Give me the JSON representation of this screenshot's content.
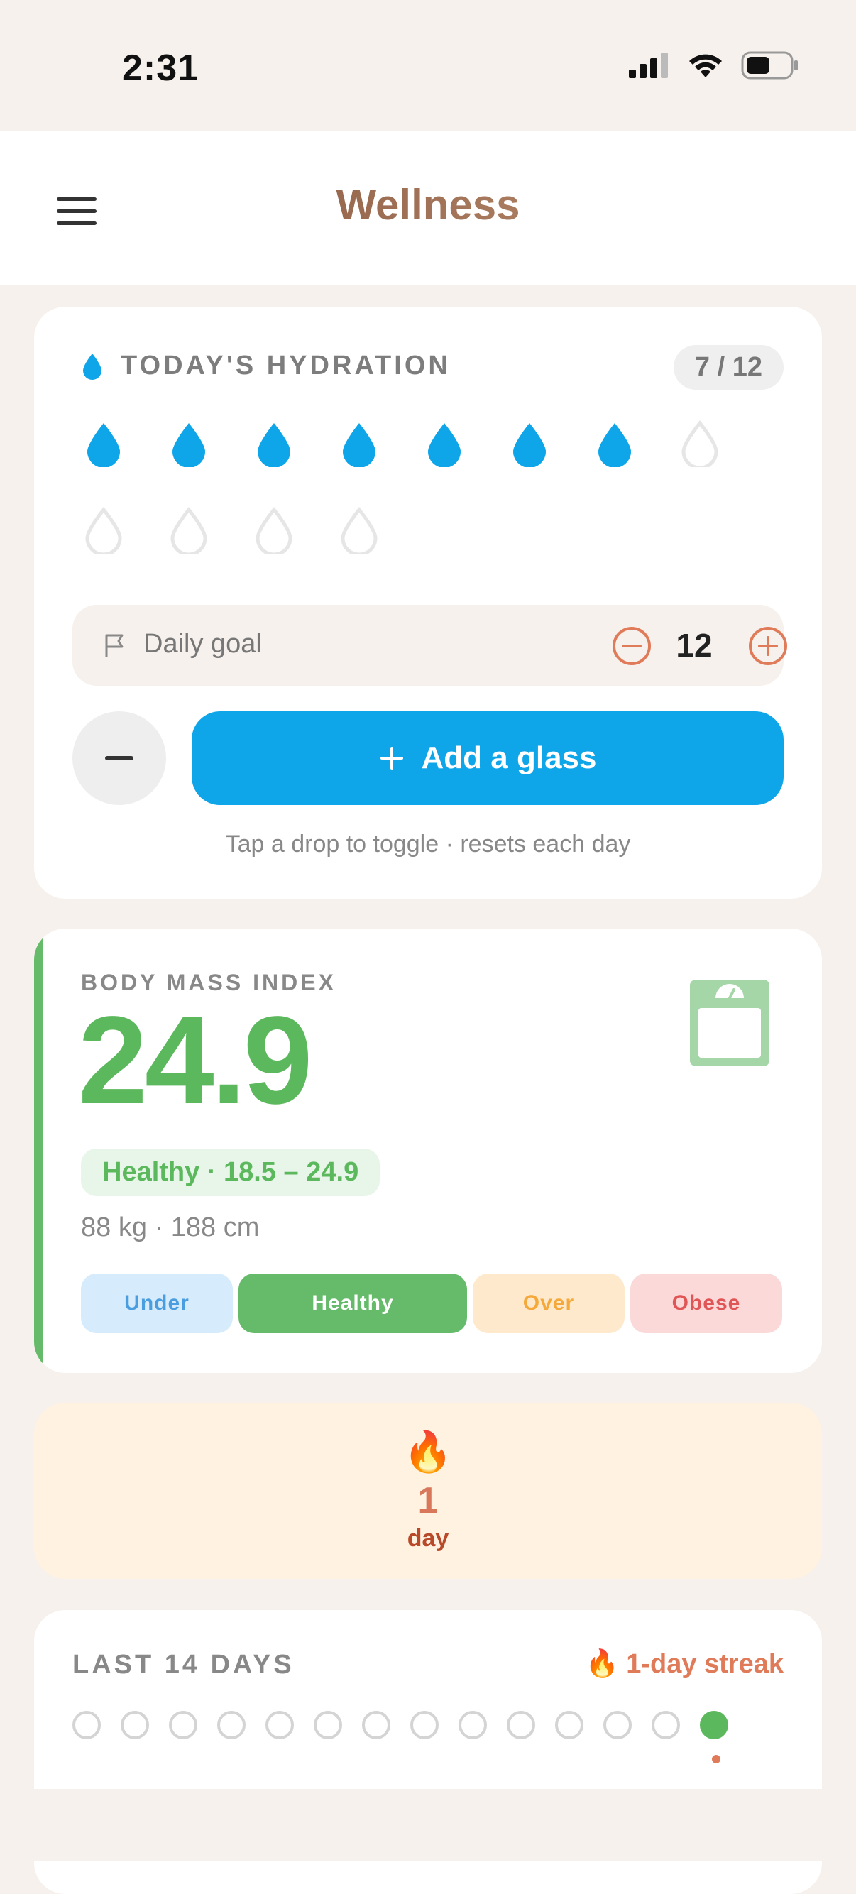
{
  "status_bar": {
    "time": "2:31"
  },
  "header": {
    "title": "Wellness"
  },
  "hydration": {
    "title": "TODAY'S HYDRATION",
    "count": "7 / 12",
    "filled": 7,
    "total": 12,
    "goal_label": "Daily goal",
    "goal_value": "12",
    "add_label": "Add a glass",
    "hint": "Tap a drop to toggle · resets each day",
    "color": "#0ea5e9"
  },
  "bmi": {
    "label": "BODY MASS INDEX",
    "value": "24.9",
    "badge": "Healthy  ·  18.5 – 24.9",
    "measurements": "88 kg  ·  188 cm",
    "scale": [
      "Under",
      "Healthy",
      "Over",
      "Obese"
    ],
    "color": "#5cb85c"
  },
  "streak": {
    "icon": "🔥",
    "count": "1",
    "unit": "day"
  },
  "history": {
    "title": "LAST 14 DAYS",
    "streak_label": "1-day streak",
    "days": [
      false,
      false,
      false,
      false,
      false,
      false,
      false,
      false,
      false,
      false,
      false,
      false,
      false,
      true
    ]
  }
}
